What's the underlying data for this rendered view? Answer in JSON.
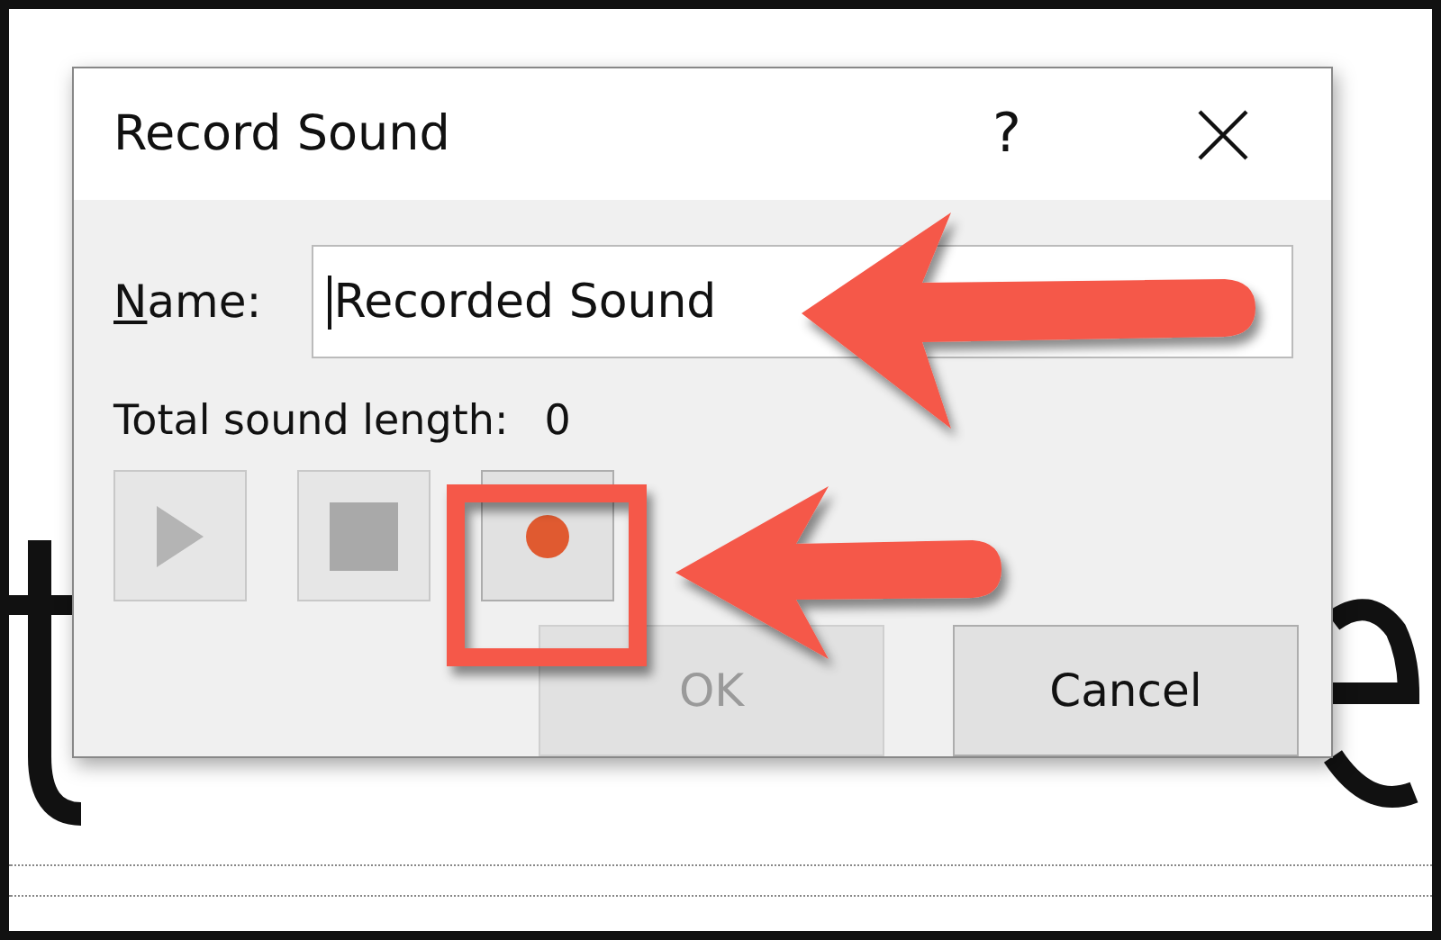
{
  "dialog": {
    "title": "Record Sound",
    "help": "?",
    "name_field": {
      "label": "Name:",
      "mnemonic_underlined": true,
      "value": "Recorded Sound",
      "focused": true
    },
    "length_label": "Total sound length:",
    "length_value": "0",
    "controls": [
      {
        "kind": "play",
        "disabled": true
      },
      {
        "kind": "stop",
        "disabled": true
      },
      {
        "kind": "record",
        "disabled": false
      }
    ],
    "buttons": [
      {
        "label": "OK",
        "disabled": true
      },
      {
        "label": "Cancel",
        "disabled": false
      }
    ]
  }
}
